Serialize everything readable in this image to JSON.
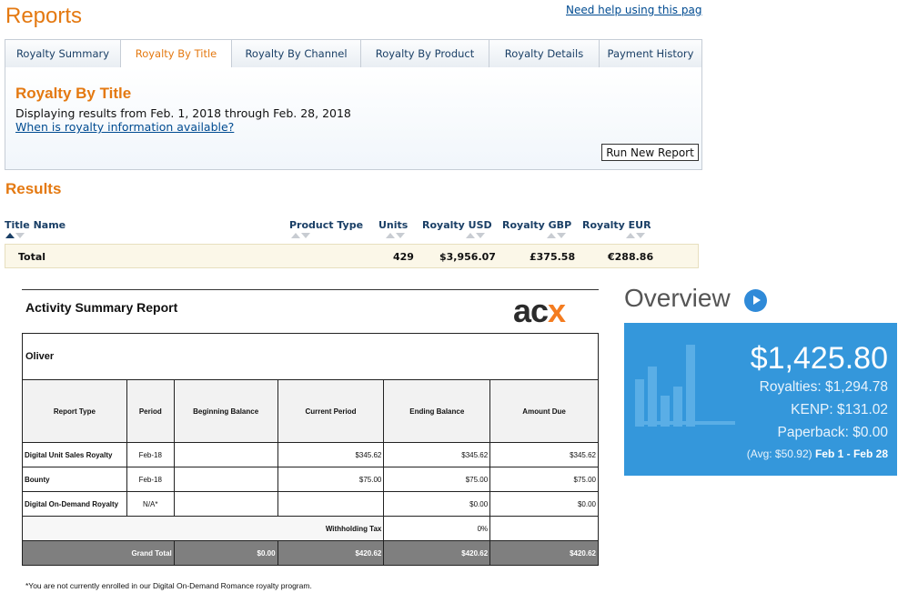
{
  "reports": {
    "title": "Reports",
    "help_link": "Need help using this pag",
    "tabs": [
      {
        "label": "Royalty Summary"
      },
      {
        "label": "Royalty By Title"
      },
      {
        "label": "Royalty By Channel"
      },
      {
        "label": "Royalty By Product"
      },
      {
        "label": "Royalty Details"
      },
      {
        "label": "Payment History"
      }
    ],
    "active_tab": "Royalty By Title",
    "panel": {
      "heading": "Royalty By Title",
      "date_range": "Displaying results from Feb. 1, 2018 through Feb. 28, 2018",
      "availability_link": "When is royalty information available?",
      "run_button": "Run New Report"
    },
    "results_heading": "Results",
    "columns": [
      "Title Name",
      "Product Type",
      "Units",
      "Royalty USD",
      "Royalty GBP",
      "Royalty EUR"
    ],
    "total_row": {
      "label": "Total",
      "units": "429",
      "usd": "$3,956.07",
      "gbp": "£375.58",
      "eur": "€288.86"
    },
    "colors": {
      "accent": "#e47911",
      "link": "#004b91",
      "header_text": "#1a3f66"
    }
  },
  "acx": {
    "title": "Activity Summary Report",
    "logo": {
      "a": "ac",
      "x": "x"
    },
    "account_name": "Oliver",
    "headers": [
      "Report Type",
      "Period",
      "Beginning Balance",
      "Current Period",
      "Ending Balance",
      "Amount Due"
    ],
    "rows": [
      {
        "type": "Digital Unit Sales Royalty",
        "period": "Feb-18",
        "beginning": "",
        "current": "$345.62",
        "ending": "$345.62",
        "due": "$345.62"
      },
      {
        "type": "Bounty",
        "period": "Feb-18",
        "beginning": "",
        "current": "$75.00",
        "ending": "$75.00",
        "due": "$75.00"
      },
      {
        "type": "Digital On-Demand Royalty",
        "period": "N/A*",
        "beginning": "",
        "current": "",
        "ending": "$0.00",
        "due": "$0.00"
      }
    ],
    "withholding": {
      "label": "Withholding Tax",
      "value": "0%"
    },
    "grand_total": {
      "label": "Grand Total",
      "beginning": "$0.00",
      "current": "$420.62",
      "ending": "$420.62",
      "due": "$420.62"
    },
    "footnote": "*You are not currently enrolled in our Digital On-Demand Romance royalty program."
  },
  "overview": {
    "title": "Overview",
    "total": "$1,425.80",
    "royalties": "Royalties: $1,294.78",
    "kenp": "KENP: $131.02",
    "paperback": "Paperback: $0.00",
    "avg": "(Avg: $50.92)",
    "range": "Feb 1 - Feb 28",
    "card_color": "#3497db"
  }
}
